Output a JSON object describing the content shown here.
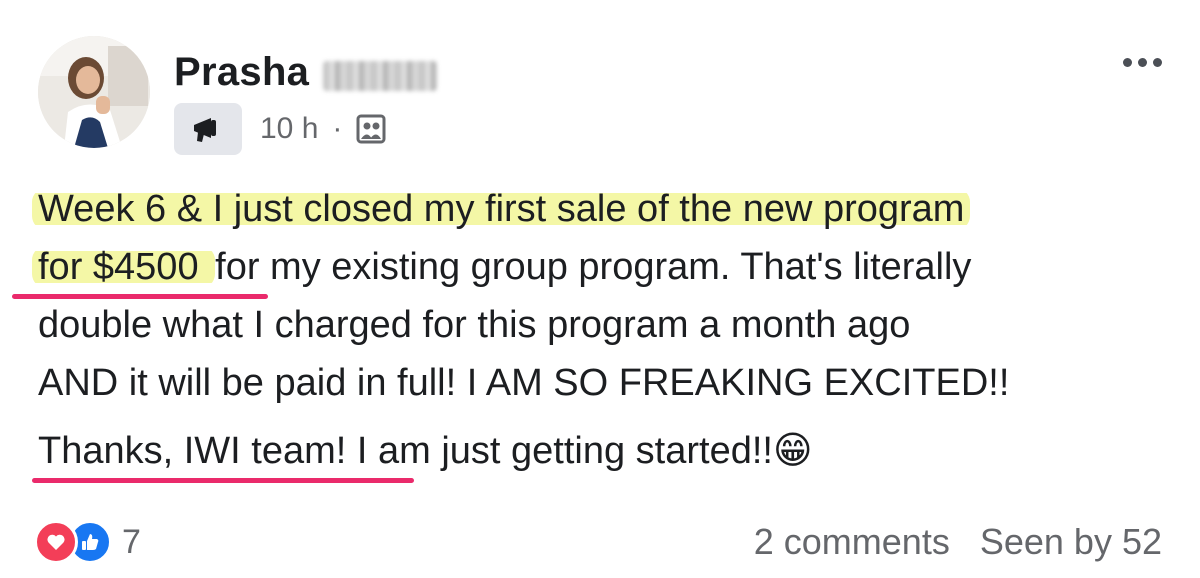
{
  "author": {
    "first_name": "Prasha"
  },
  "meta": {
    "time": "10 h",
    "separator": "·",
    "badge_icon": "megaphone-icon",
    "audience_icon": "group-icon"
  },
  "post": {
    "lines": [
      {
        "highlight": "Week 6 & I just closed my first sale of the new program",
        "rest": ""
      },
      {
        "highlight": "for $4500 ",
        "rest": "for my existing group program. That's literally"
      },
      {
        "highlight": "",
        "rest": "double what I charged for this program a month ago"
      },
      {
        "highlight": "",
        "rest": "AND it will be paid in full! I AM SO FREAKING EXCITED!!"
      },
      {
        "highlight": "",
        "rest": "Thanks, IWI team! I am just getting started!!"
      }
    ],
    "emoji": "😁"
  },
  "footer": {
    "reaction_count": "7",
    "comments": "2 comments",
    "seen_by": "Seen by 52",
    "reactions": [
      "love-icon",
      "like-icon"
    ]
  },
  "colors": {
    "highlight": "#f4f7a6",
    "underline": "#ea2a6b",
    "like": "#1877f2",
    "love": "#f33e58",
    "secondary_text": "#65676b"
  }
}
